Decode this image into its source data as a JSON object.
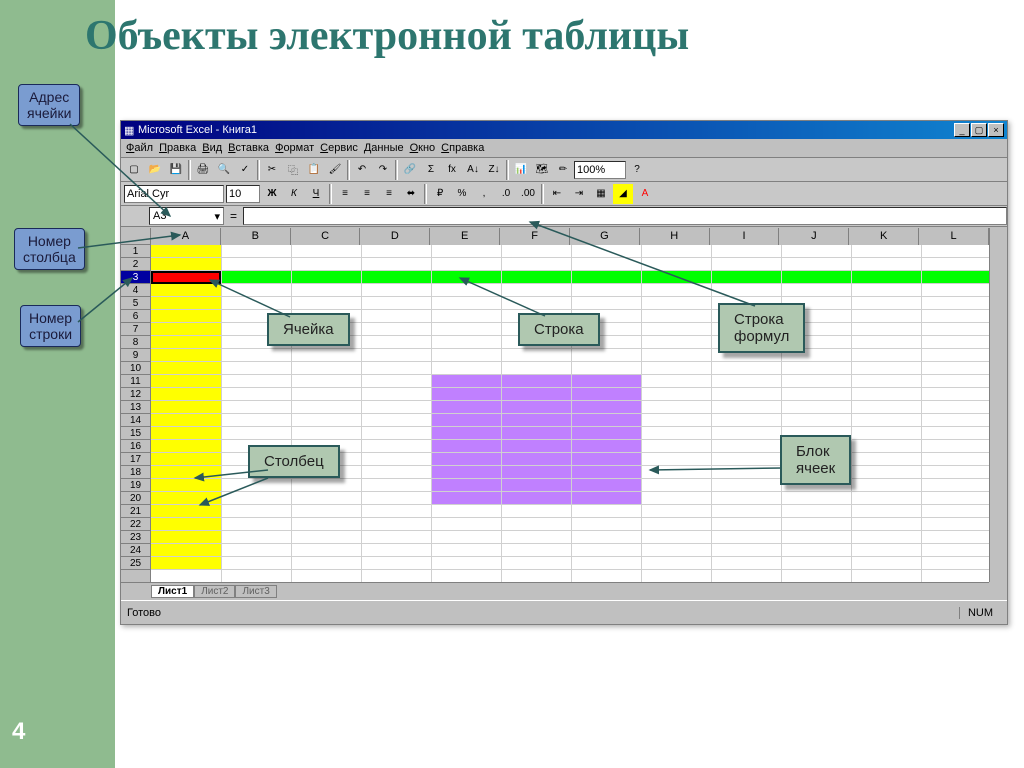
{
  "title": "Объекты электронной таблицы",
  "slide_number": "4",
  "excel": {
    "title": "Microsoft Excel - Книга1",
    "menus": [
      "Файл",
      "Правка",
      "Вид",
      "Вставка",
      "Формат",
      "Сервис",
      "Данные",
      "Окно",
      "Справка"
    ],
    "font_name": "Arial Cyr",
    "font_size": "10",
    "zoom": "100%",
    "namebox": "A3",
    "columns": [
      "A",
      "B",
      "C",
      "D",
      "E",
      "F",
      "G",
      "H",
      "I",
      "J",
      "K",
      "L"
    ],
    "row_count": 25,
    "selected_row": 3,
    "tabs": [
      "Лист1",
      "Лист2",
      "Лист3"
    ],
    "active_tab": 0,
    "status_ready": "Готово",
    "status_num": "NUM"
  },
  "callouts": {
    "address": "Адрес\nячейки",
    "col_num": "Номер\nстолбца",
    "row_num": "Номер\nстроки",
    "cell": "Ячейка",
    "row": "Строка",
    "formula_bar": "Строка\nформул",
    "column": "Столбец",
    "block": "Блок\nячеек"
  }
}
